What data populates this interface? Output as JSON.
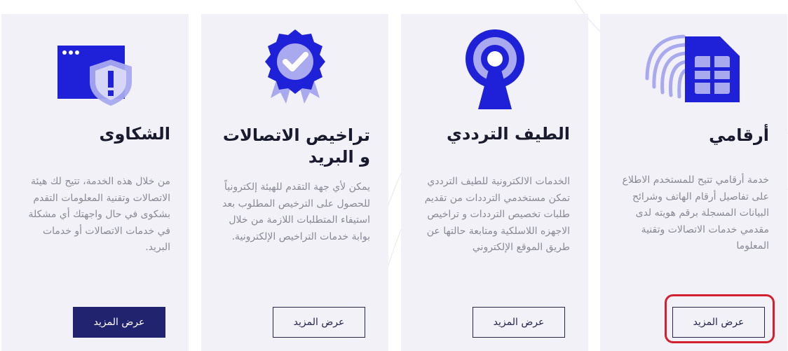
{
  "cards": [
    {
      "id": "complaints",
      "title": "الشكاوى",
      "description": "من خلال هذه الخدمة، تتيح لك هيئة الاتصالات وتقنية المعلومات التقدم بشكوى في حال واجهتك أي مشكلة في خدمات الاتصالات أو خدمات البريد.",
      "button_label": "عرض المزيد",
      "icon": "window-shield-icon"
    },
    {
      "id": "licenses",
      "title": "تراخيص الاتصالات و البريد",
      "description": "يمكن لأي جهة التقدم للهيئة إلكترونياً للحصول على الترخيص المطلوب بعد استيفاء المتطلبات اللازمة من خلال بوابة خدمات التراخيص الإلكترونية.",
      "button_label": "عرض المزيد",
      "icon": "badge-check-icon"
    },
    {
      "id": "spectrum",
      "title": "الطيف الترددي",
      "description": "الخدمات الالكترونية للطيف الترددي تمكن مستخدمي الترددات من تقديم طلبات تخصيص الترددات و تراخيص الاجهزه اللاسلكية ومتابعة حالتها عن طريق الموقع الإلكتروني",
      "button_label": "عرض المزيد",
      "icon": "antenna-icon"
    },
    {
      "id": "arqami",
      "title": "أرقامي",
      "description": "خدمة أرقامي تتيح للمستخدم الاطلاع على تفاصيل أرقام الهاتف وشرائح البيانات المسجلة برقم هويته لدى مقدمي خدمات الاتصالات وتقنية المعلوما",
      "button_label": "عرض المزيد",
      "icon": "sim-fingerprint-icon"
    }
  ],
  "colors": {
    "primary": "#1e21d8",
    "primary_light": "#a8a9ef",
    "card_bg": "#f1f1f7",
    "button_dark": "#22236e",
    "highlight": "#d2202f"
  }
}
